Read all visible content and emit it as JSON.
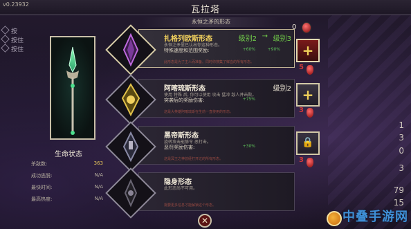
{
  "version": "v0.23932",
  "title": "瓦拉塔",
  "subtitle": "永恒之矛的形态",
  "top_counter": "0",
  "left_hints": [
    {
      "text": "按"
    },
    {
      "text": "按住"
    },
    {
      "text": "按住"
    }
  ],
  "stats": {
    "heading": "生命状态",
    "rows": [
      {
        "label": "杀敌数:",
        "value": "363"
      },
      {
        "label": "成功逃脱:",
        "value": "N/A"
      },
      {
        "label": "最快时间:",
        "value": "N/A"
      },
      {
        "label": "最高热度:",
        "value": "N/A"
      }
    ]
  },
  "aspects": [
    {
      "name": "扎格列欧斯形态",
      "desc": "永恒之矛里已认出你这种形态。",
      "bonus_label": "特殊速度和范围奖励:",
      "bonus_from": "+60%",
      "bonus_to": "+90%",
      "level_from": "级别2",
      "level_to": "级别3",
      "flavor": "此形态是为了主人而准备。同时你搜集了鲜血的所有形态。",
      "selected": true
    },
    {
      "name": "阿喀琉斯形态",
      "desc": "使用 特殊 后, 你可以使用 攻击 猛冲 敌人并击败。",
      "bonus_label": "突袭后的奖励伤害:",
      "bonus_val": "+75%",
      "level": "级别2",
      "flavor": "这是大英雄阿喀琉斯在生前一直使用的形态。",
      "selected": false
    },
    {
      "name": "黑帝斯形态",
      "desc": "旋转攻击能够令 恶打击。",
      "bonus_label": "恶罚奖励伤害:",
      "bonus_val": "+30%",
      "level": "",
      "flavor": "这是冥王之神曾经打开过的所有形态。",
      "selected": false
    },
    {
      "name": "隐身形态",
      "desc": "此形态尚不可用。",
      "bonus_label": "",
      "bonus_val": "",
      "level": "",
      "flavor": "需要更多信息才能解锁这个形态。",
      "selected": false
    }
  ],
  "upgrade_buttons": [
    {
      "icon": "plus-icon",
      "cost": "5"
    },
    {
      "icon": "plus-icon",
      "cost": "3"
    },
    {
      "icon": "lock-icon",
      "cost": "3"
    }
  ],
  "right_numbers": [
    "1",
    "3",
    "0",
    "3",
    "79",
    "15"
  ],
  "watermark": "中叠手游网",
  "colors": {
    "accent_gold": "#f2d15e",
    "level_green": "#73d04a",
    "key_red": "#d23a3a"
  }
}
